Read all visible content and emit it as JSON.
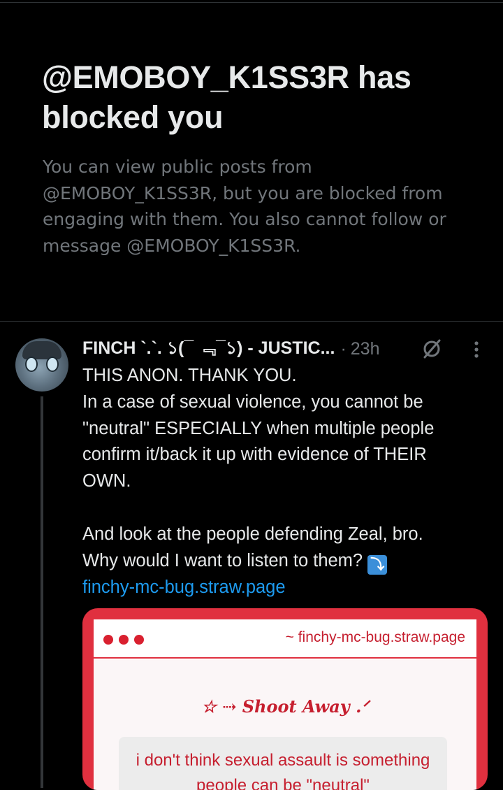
{
  "blocked_notice": {
    "title": "@EMOBOY_K1SS3R has blocked you",
    "description": "You can view public posts from @EMOBOY_K1SS3R, but you are blocked from engaging with them. You also cannot follow or message @EMOBOY_K1SS3R."
  },
  "tweet": {
    "author_name": "FINCH `.`. ১(¯ ﹃¯১) - JUSTIC...",
    "separator": "·",
    "time": "23h",
    "hidden_icon": "slashed-circle-icon",
    "more_icon": "more-vertical-icon",
    "lines": [
      "THIS ANON. THANK YOU.",
      "In a case of sexual violence, you cannot be",
      "\"neutral\" ESPECIALLY when multiple people",
      "confirm it/back it up with evidence of THEIR",
      "OWN.",
      "",
      "And look at the people defending Zeal, bro."
    ],
    "last_line": "Why would I want to listen to them?",
    "emoji": "⤵",
    "link": "finchy-mc-bug.straw.page"
  },
  "card": {
    "url": "~ finchy-mc-bug.straw.page",
    "heading": "☆ ⇢ Shoot Away .ᐟ",
    "quote": "i don't think sexual assault is something people can be \"neutral\"",
    "accent_color": "#e0303f",
    "text_color": "#c61f2f"
  },
  "colors": {
    "background": "#000000",
    "primary_text": "#e7e9ea",
    "secondary_text": "#71767b",
    "link": "#1d9bf0"
  }
}
